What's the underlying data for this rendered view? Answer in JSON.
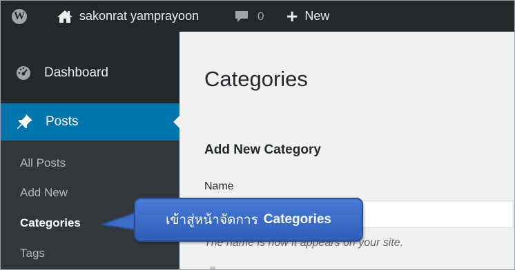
{
  "adminbar": {
    "logo_icon": "wordpress-logo-icon",
    "site_icon": "home-icon",
    "site_name": "sakonrat yamprayoon",
    "comments_icon": "comment-bubble-icon",
    "comments_count": "0",
    "new_icon": "plus-icon",
    "new_label": "New"
  },
  "sidebar": {
    "dashboard": {
      "icon": "dashboard-gauge-icon",
      "label": "Dashboard"
    },
    "posts": {
      "icon": "pushpin-icon",
      "label": "Posts"
    },
    "submenu": [
      "All Posts",
      "Add New",
      "Categories",
      "Tags"
    ]
  },
  "main": {
    "page_title": "Categories",
    "form_title": "Add New Category",
    "name_label": "Name",
    "name_value": "",
    "help_text": "The name is how it appears on your site."
  },
  "callout": {
    "text_thai": "เข้าสู่หน้าจัดการ",
    "text_bold": "Categories"
  },
  "colors": {
    "adminbar_bg": "#23282d",
    "sidebar_bg": "#23282d",
    "submenu_bg": "#32373c",
    "active_menu": "#0073aa",
    "content_bg": "#f1f1f1",
    "callout_bg": "#3c6cc6"
  }
}
